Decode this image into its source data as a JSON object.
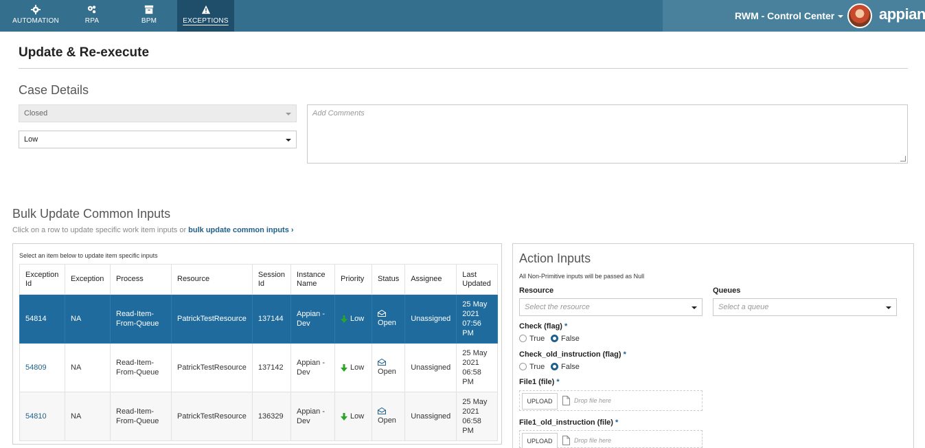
{
  "nav": {
    "tabs": [
      {
        "label": "AUTOMATION",
        "icon": "gear-icon"
      },
      {
        "label": "RPA",
        "icon": "gears-icon"
      },
      {
        "label": "BPM",
        "icon": "archive-icon"
      },
      {
        "label": "EXCEPTIONS",
        "icon": "warning-icon"
      }
    ],
    "app_title": "RWM - Control Center",
    "logo": "appian"
  },
  "page": {
    "title": "Update & Re-execute"
  },
  "case_details": {
    "title": "Case Details",
    "status_value": "Closed",
    "priority_value": "Low",
    "comments_placeholder": "Add Comments"
  },
  "bulk": {
    "title": "Bulk Update Common Inputs",
    "hint_prefix": "Click on a row to update specific work item inputs or ",
    "hint_link": "bulk update common inputs",
    "table_note": "Select an item below to update item specific inputs",
    "headers": [
      "Exception Id",
      "Exception",
      "Process",
      "Resource",
      "Session Id",
      "Instance Name",
      "Priority",
      "Status",
      "Assignee",
      "Last Updated"
    ],
    "rows": [
      {
        "id": "54814",
        "exception": "NA",
        "process": "Read-Item-From-Queue",
        "resource": "PatrickTestResource",
        "session": "137144",
        "instance": "Appian - Dev",
        "priority": "Low",
        "status": "Open",
        "assignee": "Unassigned",
        "updated": "25 May 2021 07:56 PM"
      },
      {
        "id": "54809",
        "exception": "NA",
        "process": "Read-Item-From-Queue",
        "resource": "PatrickTestResource",
        "session": "137142",
        "instance": "Appian - Dev",
        "priority": "Low",
        "status": "Open",
        "assignee": "Unassigned",
        "updated": "25 May 2021 06:58 PM"
      },
      {
        "id": "54810",
        "exception": "NA",
        "process": "Read-Item-From-Queue",
        "resource": "PatrickTestResource",
        "session": "136329",
        "instance": "Appian - Dev",
        "priority": "Low",
        "status": "Open",
        "assignee": "Unassigned",
        "updated": "25 May 2021 06:58 PM"
      }
    ]
  },
  "action_inputs": {
    "title": "Action Inputs",
    "note": "All Non-Primitive inputs will be passed as Null",
    "resource_label": "Resource",
    "resource_placeholder": "Select the resource",
    "queues_label": "Queues",
    "queues_placeholder": "Select a queue",
    "check_label": "Check (flag)",
    "check_old_label": "Check_old_instruction (flag)",
    "true_label": "True",
    "false_label": "False",
    "file1_label": "File1 (file)",
    "file1_old_label": "File1_old_instruction (file)",
    "upload_label": "UPLOAD",
    "drop_label": "Drop file here",
    "required_mark": "*"
  },
  "colors": {
    "topbar": "#356f8e",
    "selected_row": "#1f6b9e",
    "link": "#1f5f8b",
    "priority_low": "#2aa52a"
  }
}
